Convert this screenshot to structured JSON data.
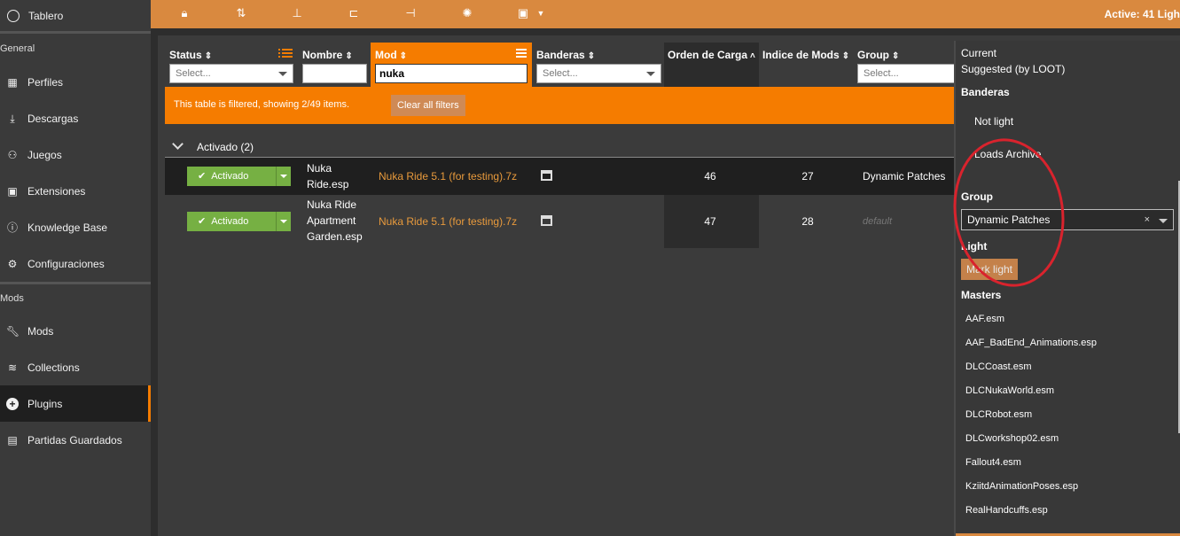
{
  "sidebar": {
    "top": "Tablero",
    "section_general": "General",
    "section_mods": "Mods",
    "general_items": [
      "Perfiles",
      "Descargas",
      "Juegos",
      "Extensiones",
      "Knowledge Base",
      "Configuraciones"
    ],
    "mods_items": [
      "Mods",
      "Collections",
      "Plugins",
      "Partidas Guardados"
    ],
    "active_item": "Plugins"
  },
  "toolbar": {
    "active_count": "Active: 41 Ligh"
  },
  "columns": {
    "status": "Status",
    "nombre": "Nombre",
    "mod": "Mod",
    "banderas": "Banderas",
    "orden": "Orden de Carga",
    "indice": "Indice de Mods",
    "group": "Group",
    "select_placeholder": "Select...",
    "mod_filter_value": "nuka"
  },
  "filter_bar": {
    "text": "This table is filtered, showing 2/49 items.",
    "clear_label": "Clear all filters"
  },
  "group_header": "Activado (2)",
  "rows": [
    {
      "status": "Activado",
      "name": "Nuka Ride.esp",
      "name_l1": "Nuka",
      "name_l2": "Ride.esp",
      "mod": "Nuka Ride 5.1 (for testing).7z",
      "load_order": "46",
      "mod_index": "27",
      "group": "Dynamic Patches"
    },
    {
      "status": "Activado",
      "name_l1": "Nuka Ride",
      "name_l2": "Apartment",
      "name_l3": "Garden.esp",
      "mod": "Nuka Ride 5.1 (for testing).7z",
      "load_order": "47",
      "mod_index": "28",
      "group": "default"
    }
  ],
  "details": {
    "current": "Current",
    "suggested": "Suggested (by LOOT)",
    "banderas_head": "Banderas",
    "flags": [
      "Not light",
      "Loads Archive"
    ],
    "group_head": "Group",
    "group_value": "Dynamic Patches",
    "clear_x": "×",
    "light_head": "Light",
    "mark_light": "Mark light",
    "masters_head": "Masters",
    "masters": [
      "AAF.esm",
      "AAF_BadEnd_Animations.esp",
      "DLCCoast.esm",
      "DLCNukaWorld.esm",
      "DLCRobot.esm",
      "DLCworkshop02.esm",
      "Fallout4.esm",
      "KziitdAnimationPoses.esp",
      "RealHandcuffs.esp"
    ]
  },
  "colors": {
    "accent": "#f57c00",
    "toolbar": "#d9893f",
    "enabled_green": "#76b043",
    "annotation_red": "#d9232d"
  }
}
